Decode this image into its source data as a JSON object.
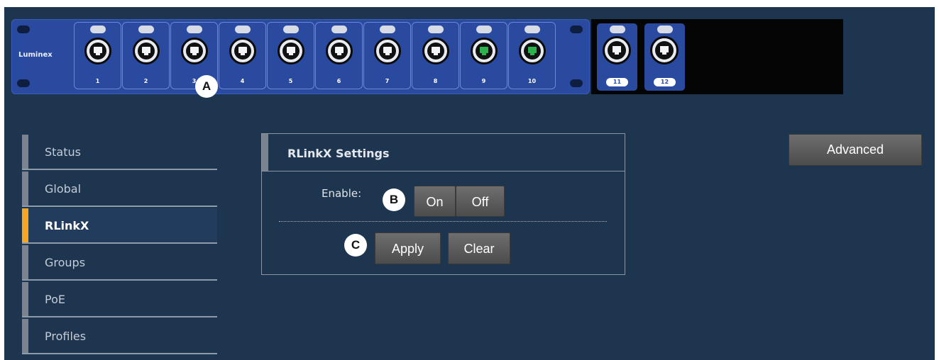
{
  "panel": {
    "brand": "Luminex",
    "ports": [
      {
        "label": "1",
        "active": false
      },
      {
        "label": "2",
        "active": false
      },
      {
        "label": "3",
        "active": false
      },
      {
        "label": "4",
        "active": false
      },
      {
        "label": "5",
        "active": false
      },
      {
        "label": "6",
        "active": false
      },
      {
        "label": "7",
        "active": false
      },
      {
        "label": "8",
        "active": false
      },
      {
        "label": "9",
        "active": true
      },
      {
        "label": "10",
        "active": true
      }
    ],
    "sfp_ports": [
      {
        "label": "11"
      },
      {
        "label": "12"
      }
    ],
    "active_color": "#2bb14e"
  },
  "callouts": {
    "a": "A",
    "b": "B",
    "c": "C"
  },
  "sidebar": {
    "items": [
      {
        "label": "Status",
        "selected": false
      },
      {
        "label": "Global",
        "selected": false
      },
      {
        "label": "RLinkX",
        "selected": true
      },
      {
        "label": "Groups",
        "selected": false
      },
      {
        "label": "PoE",
        "selected": false
      },
      {
        "label": "Profiles",
        "selected": false
      }
    ],
    "accent": "#f5a623"
  },
  "settings": {
    "title": "RLinkX Settings",
    "enable_label": "Enable:",
    "on_label": "On",
    "off_label": "Off",
    "apply_label": "Apply",
    "clear_label": "Clear"
  },
  "advanced_label": "Advanced"
}
